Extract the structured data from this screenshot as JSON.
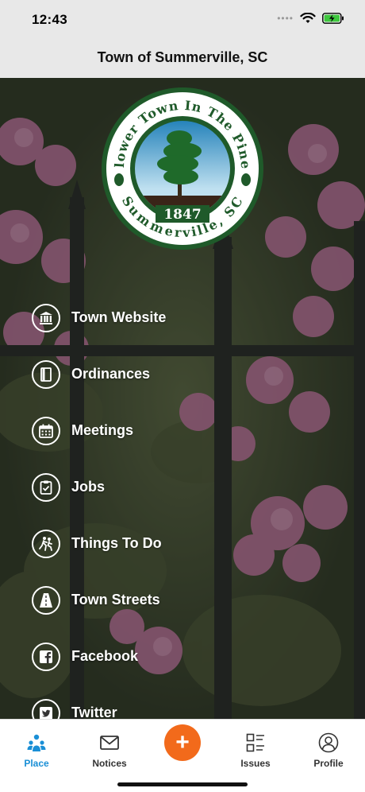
{
  "status_bar": {
    "time": "12:43"
  },
  "header": {
    "title": "Town of Summerville, SC"
  },
  "seal": {
    "top_text": "Flower Town In The Pines",
    "bottom_text": "Summerville, SC",
    "year": "1847"
  },
  "menu": {
    "items": [
      {
        "label": "Town Website",
        "icon": "building-icon"
      },
      {
        "label": "Ordinances",
        "icon": "book-icon"
      },
      {
        "label": "Meetings",
        "icon": "calendar-icon"
      },
      {
        "label": "Jobs",
        "icon": "clipboard-icon"
      },
      {
        "label": "Things To Do",
        "icon": "running-icon"
      },
      {
        "label": "Town Streets",
        "icon": "road-icon"
      },
      {
        "label": "Facebook",
        "icon": "facebook-icon"
      },
      {
        "label": "Twitter",
        "icon": "twitter-icon"
      }
    ]
  },
  "tabbar": {
    "tabs": [
      {
        "label": "Place",
        "icon": "place-icon",
        "active": true
      },
      {
        "label": "Notices",
        "icon": "envelope-icon",
        "active": false
      },
      {
        "label": "Issues",
        "icon": "list-icon",
        "active": false
      },
      {
        "label": "Profile",
        "icon": "user-icon",
        "active": false
      }
    ],
    "add_label": "+"
  },
  "colors": {
    "accent": "#1a8fd6",
    "fab": "#f26a1b",
    "seal_green": "#1f5a2a",
    "header_bg": "#e8e8e8"
  }
}
